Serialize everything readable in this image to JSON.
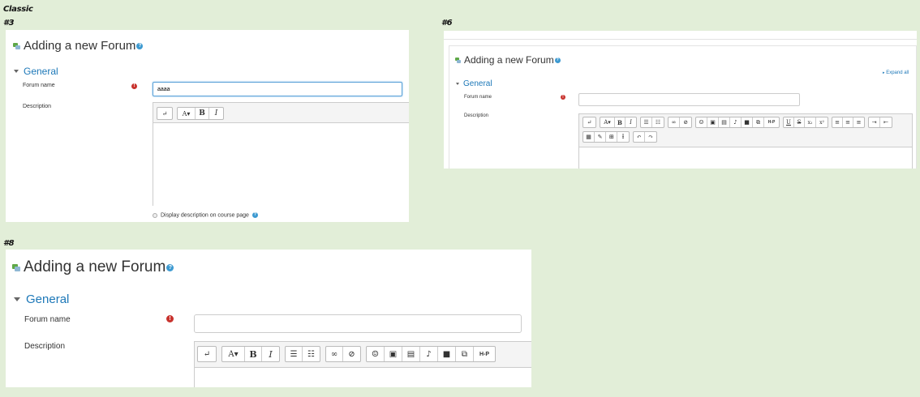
{
  "labels": {
    "classic": "Classic",
    "v3": "#3",
    "v6": "#6",
    "v8": "#8"
  },
  "colors": {
    "background": "#e2eed8",
    "link": "#1d78b8",
    "required": "#c8322d",
    "help": "#3d9ad1"
  },
  "v3": {
    "title": "Adding a new Forum",
    "section": "General",
    "forum_name_label": "Forum name",
    "forum_name_value": "aaaa",
    "description_label": "Description",
    "display_description": "Display description on course page",
    "toolbar": [
      [
        "↵"
      ],
      [
        "A▾",
        "B",
        "I"
      ]
    ]
  },
  "v6": {
    "title": "Adding a new Forum",
    "section": "General",
    "expand_all": "Expand all",
    "forum_name_label": "Forum name",
    "description_label": "Description",
    "toolbar_row1": [
      [
        "↵"
      ],
      [
        "A▾",
        "B",
        "I"
      ],
      [
        "bullets",
        "numbers"
      ],
      [
        "link",
        "unlink"
      ],
      [
        "emoji",
        "image",
        "media",
        "mic",
        "video",
        "copy",
        "h5p"
      ],
      [
        "U",
        "S",
        "x₂",
        "x²"
      ],
      [
        "align-left",
        "align-center",
        "align-right"
      ],
      [
        "indent",
        "outdent"
      ]
    ],
    "toolbar_row2": [
      [
        "calc",
        "edit",
        "table",
        "clear"
      ],
      [
        "undo",
        "redo"
      ]
    ]
  },
  "v8": {
    "title": "Adding a new Forum",
    "section": "General",
    "forum_name_label": "Forum name",
    "description_label": "Description",
    "toolbar": [
      [
        "↵"
      ],
      [
        "A▾",
        "B",
        "I"
      ],
      [
        "bullets",
        "numbers"
      ],
      [
        "link",
        "unlink"
      ],
      [
        "emoji",
        "image",
        "media",
        "mic",
        "video",
        "copy",
        "h5p"
      ]
    ]
  }
}
